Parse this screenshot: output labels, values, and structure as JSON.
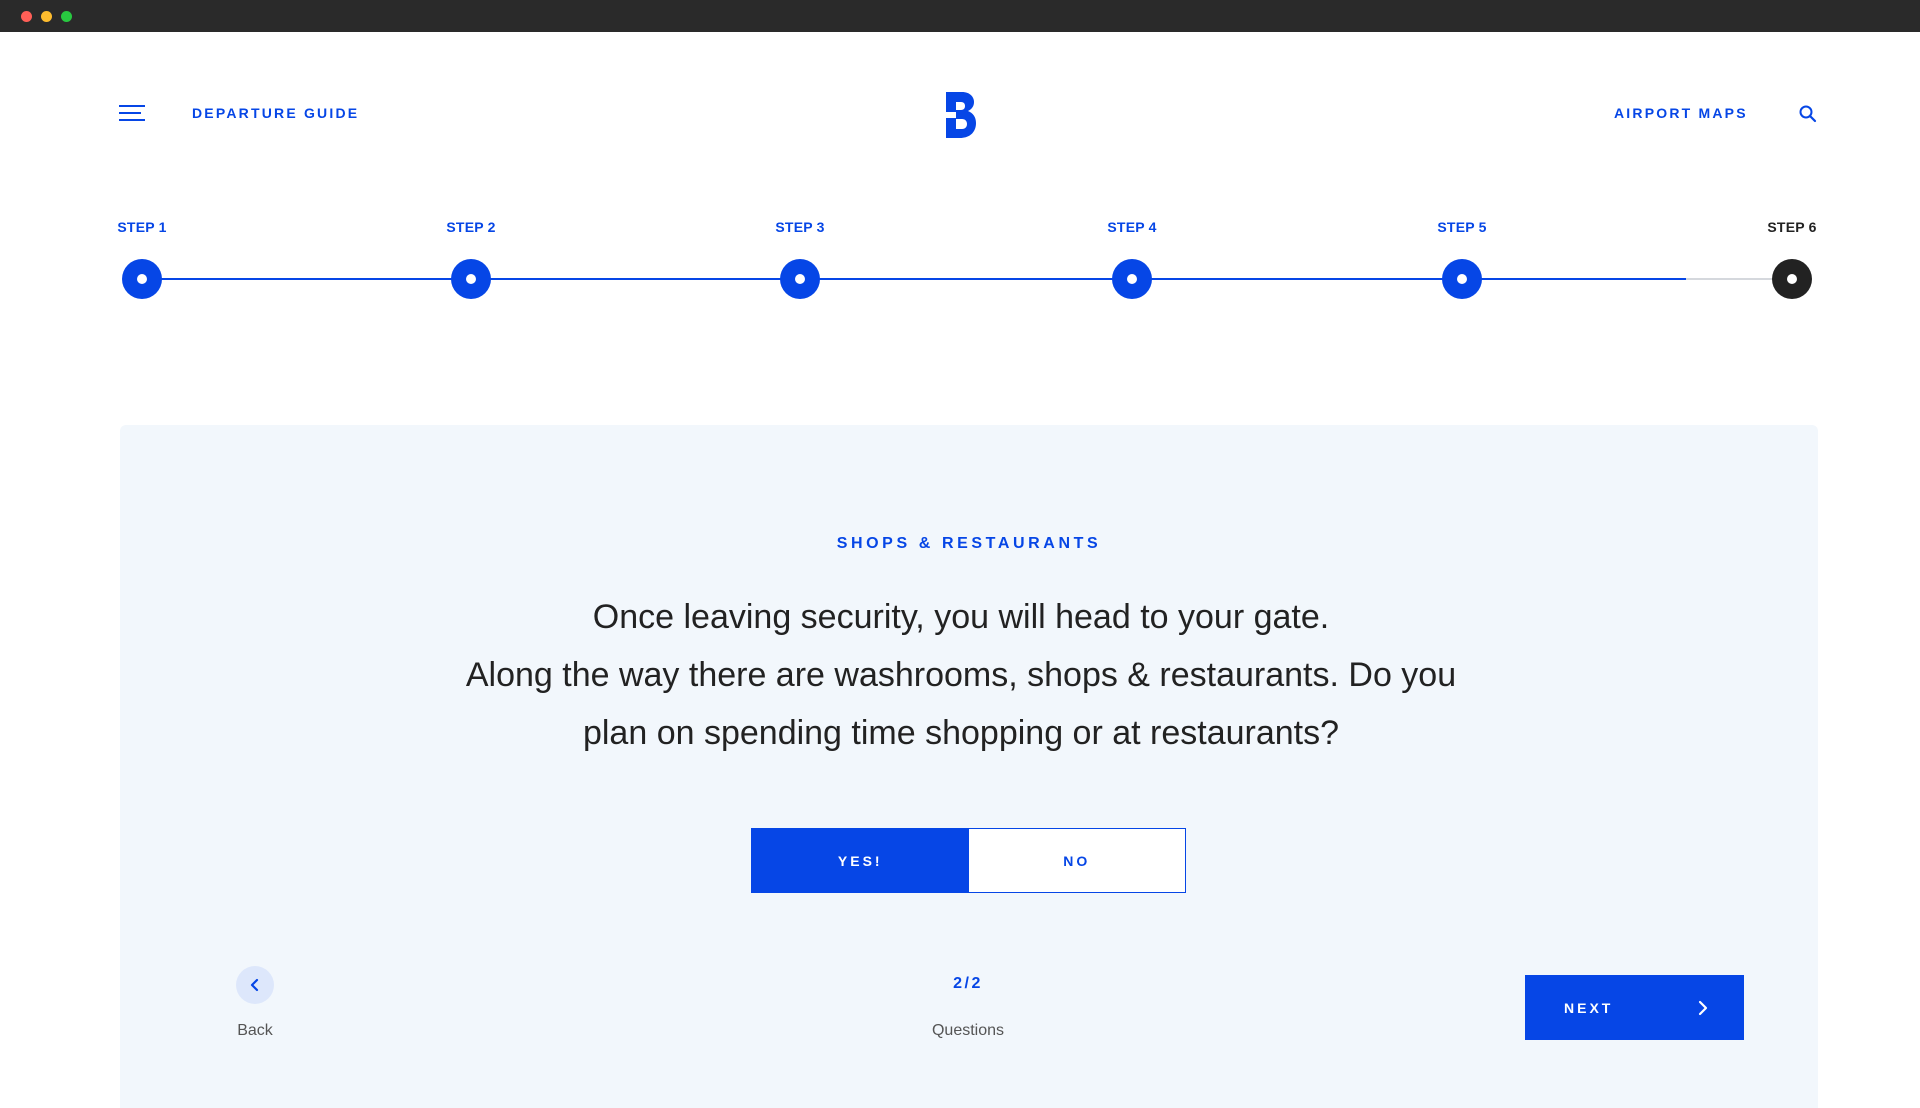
{
  "header": {
    "departure_link": "DEPARTURE GUIDE",
    "maps_link": "AIRPORT MAPS",
    "menu_icon": "hamburger-menu-icon",
    "search_icon": "search-icon",
    "logo": "brand-b-logo"
  },
  "steps": [
    {
      "label": "STEP 1",
      "status": "complete"
    },
    {
      "label": "STEP 2",
      "status": "complete"
    },
    {
      "label": "STEP 3",
      "status": "complete"
    },
    {
      "label": "STEP 4",
      "status": "complete"
    },
    {
      "label": "STEP 5",
      "status": "complete"
    },
    {
      "label": "STEP 6",
      "status": "current"
    }
  ],
  "card": {
    "section_title": "SHOPS & RESTAURANTS",
    "question_lines": [
      "Once leaving security, you will head to your gate.",
      "Along the way there are washrooms, shops & restaurants. Do you",
      "plan on spending time shopping or at restaurants?"
    ],
    "options": {
      "yes": "YES!",
      "no": "NO",
      "selected": "yes"
    },
    "back_label": "Back",
    "counter": "2/2",
    "counter_label": "Questions",
    "next_label": "NEXT"
  },
  "colors": {
    "accent": "#0646e6",
    "dark": "#222222",
    "card_bg": "#f2f7fc"
  }
}
